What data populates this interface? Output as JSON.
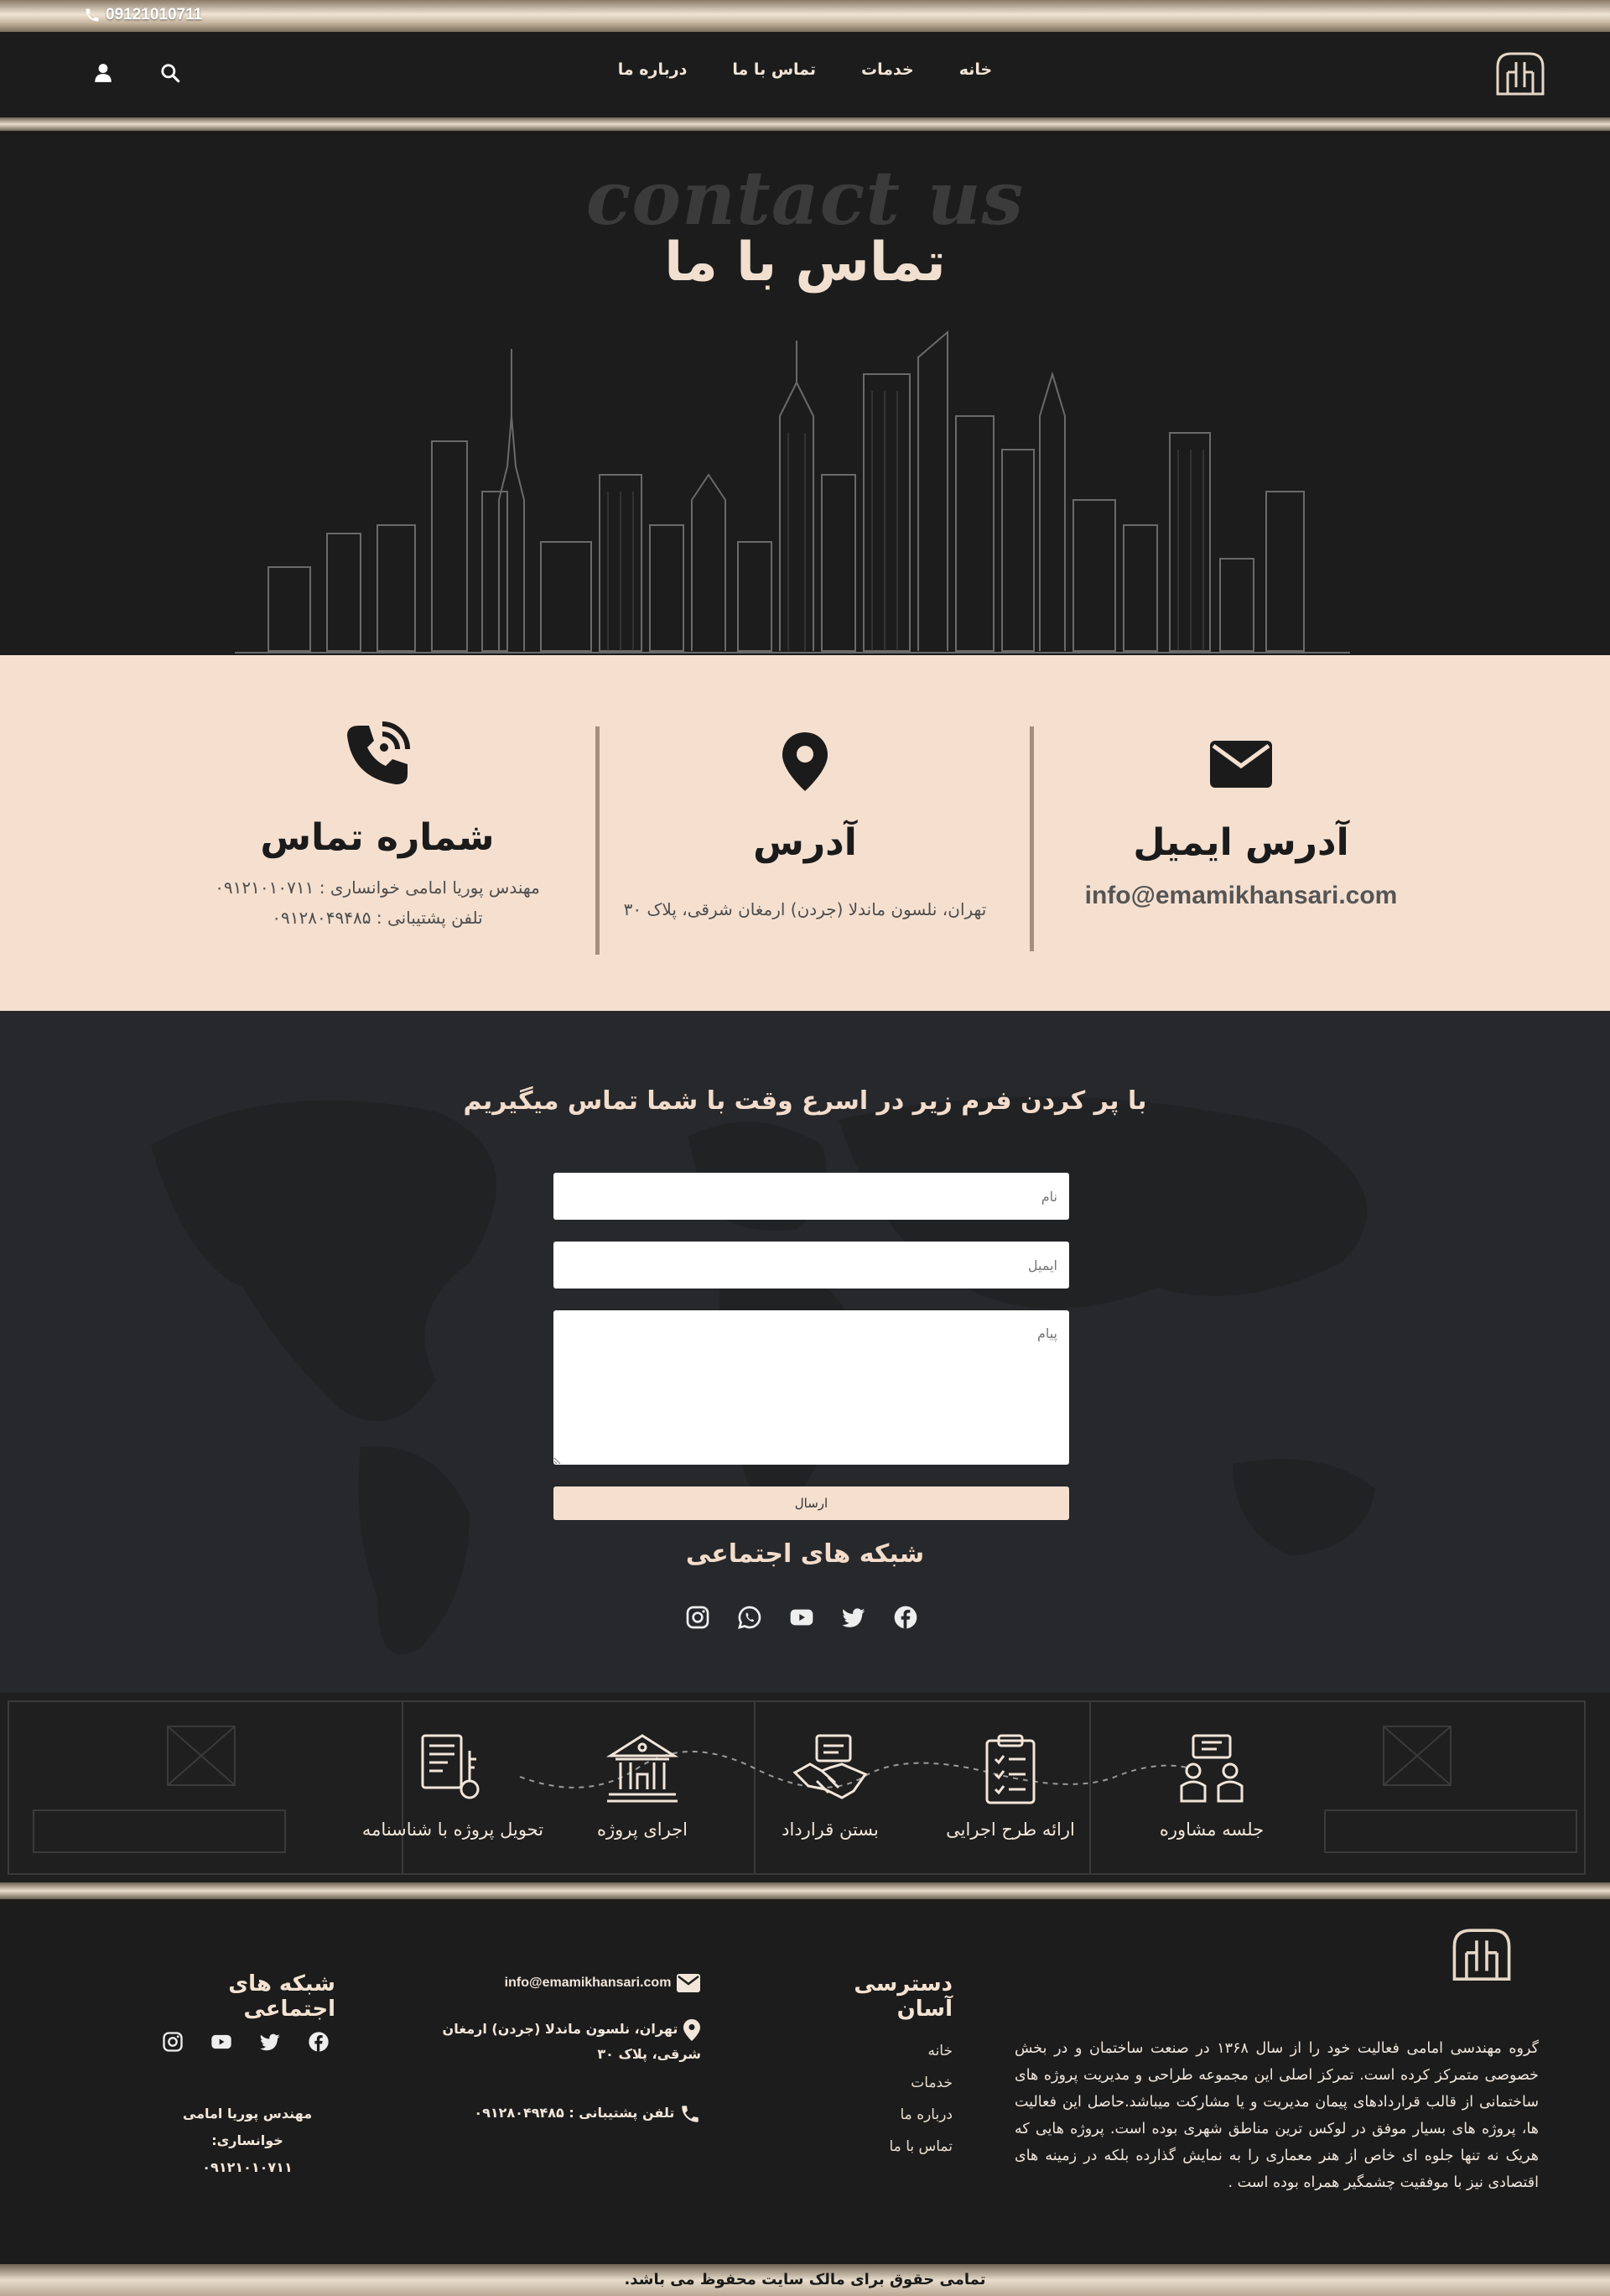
{
  "topbar": {
    "phone": "09121010711"
  },
  "nav": {
    "items": [
      "خانه",
      "خدمات",
      "تماس با ما",
      "درباره ما"
    ]
  },
  "hero": {
    "ghost_title": "contact us",
    "title": "تماس با ما"
  },
  "info": {
    "email": {
      "title": "آدرس ایمیل",
      "value": "info@emamikhansari.com"
    },
    "address": {
      "title": "آدرس",
      "value": "تهران، نلسون ماندلا (جردن) ارمغان شرقی، پلاک ۳۰"
    },
    "phone": {
      "title": "شماره تماس",
      "line1": "مهندس پوریا امامی خوانساری : ۰۹۱۲۱۰۱۰۷۱۱",
      "line2": "تلفن پشتیبانی : ۰۹۱۲۸۰۴۹۴۸۵"
    }
  },
  "form": {
    "heading": "با پر کردن فرم زیر در اسرع وقت با شما تماس میگیریم",
    "name_placeholder": "نام",
    "email_placeholder": "ایمیل",
    "message_placeholder": "پیام",
    "submit_label": "ارسال",
    "social_title": "شبکه های اجتماعی"
  },
  "process": {
    "steps": [
      "جلسه مشاوره",
      "ارائه طرح اجرایی",
      "بستن قرارداد",
      "اجرای پروژه",
      "تحویل پروژه با شناسنامه"
    ]
  },
  "footer": {
    "about": "گروه مهندسی امامی فعالیت خود را از سال ۱۳۶۸ در صنعت ساختمان و در بخش خصوصی متمرکز کرده است. تمرکز اصلی این مجموعه طراحی و مدیریت پروژه های ساختمانی از قالب قراردادهای پیمان مدیریت و یا مشارکت میباشد.حاصل این فعالیت ها، پروژه های بسیار موفق در لوکس ترین مناطق شهری بوده است. پروژه هایی که هریک نه تنها جلوه ای خاص از هنر معماری را به نمایش گذارده بلکه در زمینه های اقتصادی نیز با موفقیت چشمگیر همراه بوده است .",
    "quick_title": "دسترسی آسان",
    "quick_links": [
      "خانه",
      "خدمات",
      "درباره ما",
      "تماس با ما"
    ],
    "email": "info@emamikhansari.com",
    "address": "تهران، نلسون ماندلا (جردن) ارمغان شرقی، پلاک ۳۰",
    "support": "تلفن پشتیبانی : ۰۹۱۲۸۰۴۹۴۸۵",
    "social_title": "شبکه های اجتماعی",
    "engineer_label": "مهندس پوریا امامی خوانساری:",
    "engineer_phone": "۰۹۱۲۱۰۱۰۷۱۱"
  },
  "copyright": "تمامی حقوق برای مالک سایت محفوظ می باشد.",
  "colors": {
    "accent": "#f5e0d0",
    "dark": "#1c1c1c",
    "gold": "#a28f7c"
  },
  "icons": [
    "phone-icon",
    "search-icon",
    "user-icon",
    "envelope-icon",
    "map-pin-icon",
    "phone-wifi-icon",
    "facebook-icon",
    "twitter-icon",
    "youtube-icon",
    "whatsapp-icon",
    "instagram-icon"
  ]
}
